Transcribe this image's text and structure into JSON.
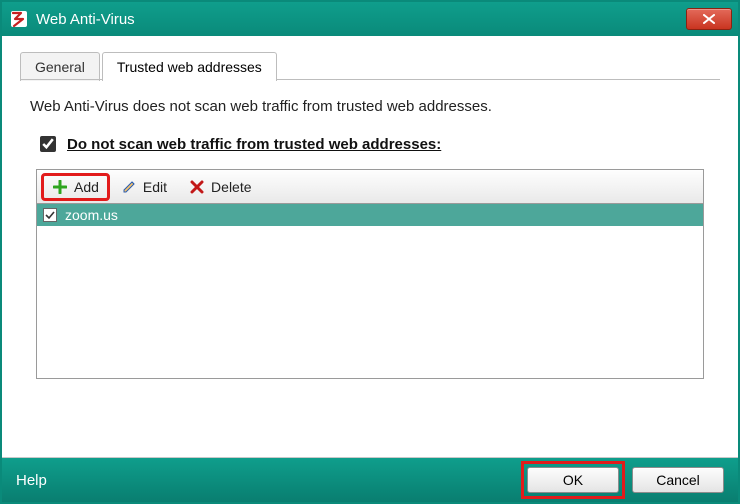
{
  "window": {
    "title": "Web Anti-Virus"
  },
  "tabs": {
    "general": "General",
    "trusted": "Trusted web addresses"
  },
  "content": {
    "description": "Web Anti-Virus does not scan web traffic from trusted web addresses.",
    "checkbox_label": "Do not scan web traffic from trusted web addresses:"
  },
  "toolbar": {
    "add": "Add",
    "edit": "Edit",
    "delete": "Delete"
  },
  "list": {
    "items": [
      {
        "checked": true,
        "label": "zoom.us"
      }
    ]
  },
  "footer": {
    "help": "Help",
    "ok": "OK",
    "cancel": "Cancel"
  }
}
